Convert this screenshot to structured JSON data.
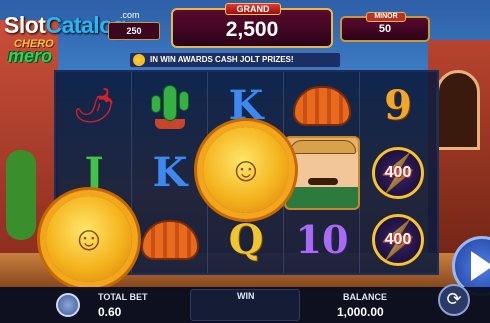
{
  "logo": {
    "brand_part1": "Slot",
    "brand_part2": "Catalog",
    "brand_dot": ".com",
    "game_line1": "CHERO",
    "game_line2": "mero"
  },
  "jackpots": {
    "left_small_value": "250",
    "grand_label": "GRAND",
    "grand_value": "2,500",
    "minor_label": "MINOR",
    "minor_value": "50"
  },
  "banner": {
    "icon": "bolt-icon",
    "text": "IN WIN AWARDS CASH JOLT PRIZES!"
  },
  "reels": {
    "columns": [
      [
        "pepper",
        "J",
        "sun"
      ],
      [
        "cactus",
        "K",
        "armadillo"
      ],
      [
        "K",
        "sun",
        "Q"
      ],
      [
        "armadillo",
        "hombre",
        "10"
      ],
      [
        "9",
        "400",
        "400"
      ]
    ]
  },
  "bottom": {
    "total_bet_label": "TOTAL BET",
    "total_bet_value": "0.60",
    "win_label": "WIN",
    "win_value": "",
    "balance_label": "BALANCE",
    "balance_value": "1,000.00"
  },
  "colors": {
    "gold": "#f5c32e",
    "reel_bg": "#0a1a3c",
    "jackpot_bg": "#5a0a2e"
  }
}
